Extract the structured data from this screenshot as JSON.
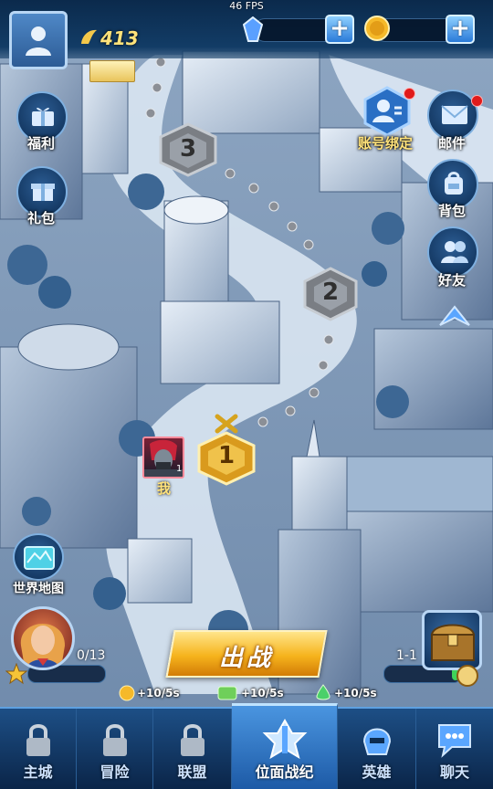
{
  "fps_text": "46 FPS",
  "player": {
    "level": "413",
    "name_label": "我",
    "portrait_level": "1"
  },
  "side_left": [
    {
      "key": "welfare",
      "label": "福利",
      "icon": "gift-box-icon"
    },
    {
      "key": "pack",
      "label": "礼包",
      "icon": "present-icon"
    }
  ],
  "side_right": [
    {
      "key": "bind",
      "label": "账号绑定",
      "icon": "account-bind-icon",
      "badge": true
    },
    {
      "key": "mail",
      "label": "邮件",
      "icon": "mail-icon",
      "badge": true
    },
    {
      "key": "bag",
      "label": "背包",
      "icon": "backpack-icon",
      "badge": false
    },
    {
      "key": "friends",
      "label": "好友",
      "icon": "friends-icon",
      "badge": false
    }
  ],
  "stages": [
    {
      "num": "3",
      "state": "locked"
    },
    {
      "num": "2",
      "state": "locked"
    },
    {
      "num": "1",
      "state": "current"
    }
  ],
  "world_map_label": "世界地图",
  "hero": {
    "count_text": "0/13"
  },
  "go_button": {
    "label": "出战"
  },
  "progress": {
    "text": "1-1",
    "fill": 0.1
  },
  "rates": [
    {
      "icon": "coin-icon",
      "text": "+10/5s"
    },
    {
      "icon": "exp-icon",
      "text": "+10/5s"
    },
    {
      "icon": "potion-icon",
      "text": "+10/5s"
    }
  ],
  "nav": [
    {
      "label": "主城",
      "active": false,
      "locked": true
    },
    {
      "label": "冒险",
      "active": false,
      "locked": true
    },
    {
      "label": "联盟",
      "active": false,
      "locked": true
    },
    {
      "label": "位面战纪",
      "active": true,
      "locked": false
    },
    {
      "label": "英雄",
      "active": false,
      "locked": false
    },
    {
      "label": "聊天",
      "active": false,
      "locked": false
    }
  ],
  "colors": {
    "accent": "#f6b31c",
    "nav_bg": "#0a2447",
    "highlight": "#ffe27a"
  }
}
